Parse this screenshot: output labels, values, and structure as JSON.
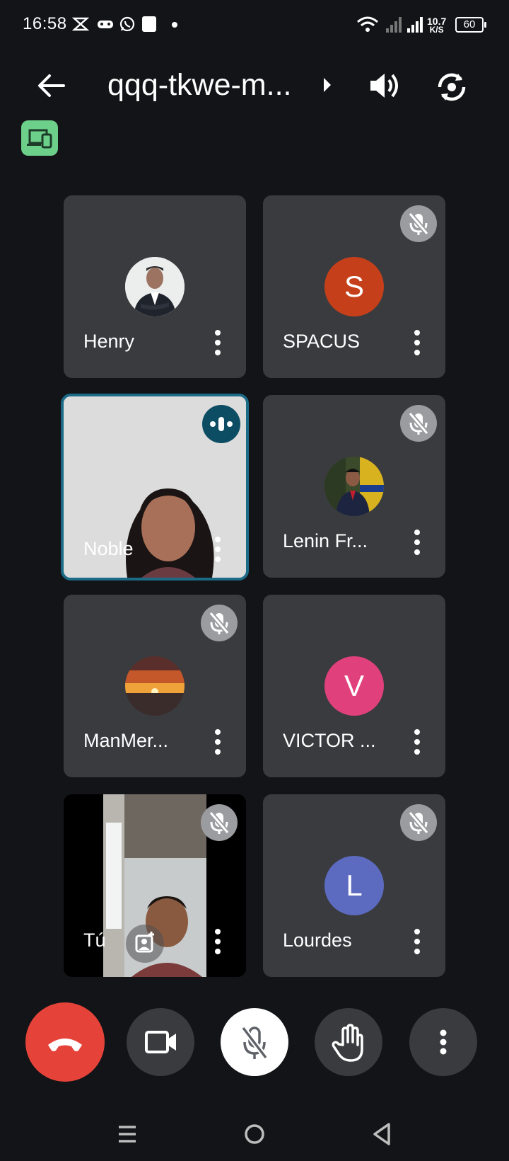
{
  "status_bar": {
    "time": "16:58",
    "net_speed_value": "10.7",
    "net_speed_unit": "K/S",
    "battery": "60"
  },
  "header": {
    "meeting_title": "qqq-tkwe-m..."
  },
  "participants": [
    {
      "name": "Henry",
      "avatar_type": "photo",
      "muted": false
    },
    {
      "name": "SPACUS",
      "avatar_type": "initial",
      "initial": "S",
      "avatar_color": "#c5401a",
      "muted": true
    },
    {
      "name": "Noble",
      "avatar_type": "video",
      "muted": false,
      "speaking": true
    },
    {
      "name": "Lenin Fr...",
      "avatar_type": "photo",
      "muted": true
    },
    {
      "name": "ManMer...",
      "avatar_type": "photo",
      "muted": true
    },
    {
      "name": "VICTOR ...",
      "avatar_type": "initial",
      "initial": "V",
      "avatar_color": "#e0407b",
      "muted": false
    },
    {
      "name": "Tú",
      "avatar_type": "video",
      "muted": true,
      "self": true
    },
    {
      "name": "Lourdes",
      "avatar_type": "initial",
      "initial": "L",
      "avatar_color": "#5c6bc0",
      "muted": true
    }
  ],
  "controls": {
    "end_call_color": "#e5433a",
    "icons": [
      "end-call-icon",
      "camera-icon",
      "mic-off-icon",
      "raise-hand-icon",
      "more-vert-icon"
    ]
  },
  "colors": {
    "background": "#131417",
    "tile": "#3a3b3f",
    "speaking_border": "#1b6b87",
    "device_badge": "#6ccf8a"
  }
}
